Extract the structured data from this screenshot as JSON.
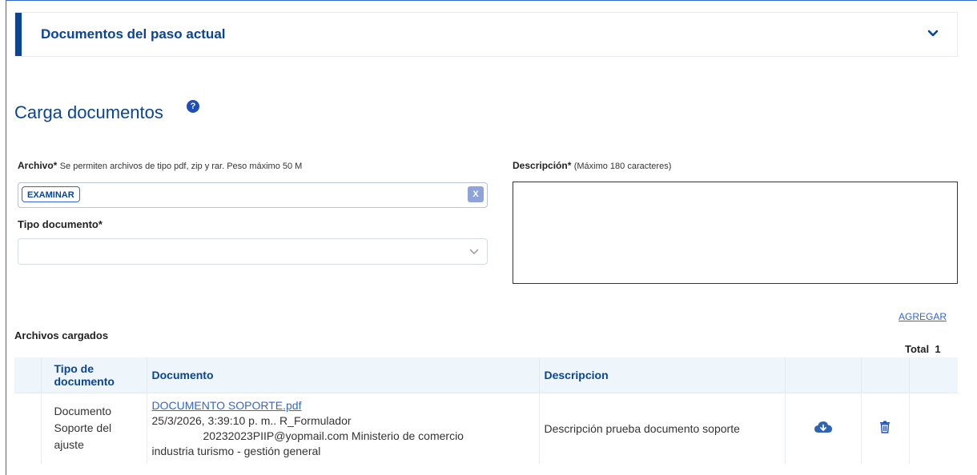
{
  "accordion": {
    "title": "Documentos del paso actual"
  },
  "section": {
    "title": "Carga documentos",
    "help_icon": "question-icon"
  },
  "form": {
    "archivo_label": "Archivo*",
    "archivo_hint": "Se permiten archivos de tipo pdf, zip y rar. Peso máximo 50 M",
    "examinar_label": "EXAMINAR",
    "clear_label": "X",
    "tipo_label": "Tipo documento*",
    "tipo_value": "",
    "descripcion_label": "Descripción*",
    "descripcion_hint": "(Máximo 180 caracteres)",
    "descripcion_value": "",
    "agregar_label": "AGREGAR"
  },
  "files": {
    "title": "Archivos cargados",
    "total_label": "Total",
    "total_value": "1",
    "columns": [
      "Tipo de documento",
      "Documento",
      "Descripcion"
    ],
    "rows": [
      {
        "tipo": "Documento Soporte del ajuste",
        "doc_name": "DOCUMENTO SOPORTE.pdf",
        "doc_meta1": "25/3/2026, 3:39:10 p. m.. R_Formulador",
        "doc_meta2": "20232023PIIP@yopmail.com Ministerio de comercio",
        "doc_meta3": "industria turismo - gestión general",
        "descripcion": "Descripción prueba documento soporte",
        "download_icon": "cloud-download-icon",
        "delete_icon": "trash-icon"
      }
    ]
  },
  "colors": {
    "primary": "#084596",
    "link": "#3366cc",
    "header_bg": "#eef6fb"
  }
}
